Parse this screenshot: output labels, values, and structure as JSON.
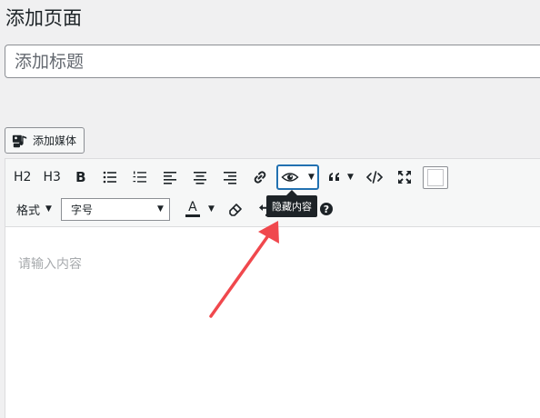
{
  "page": {
    "title": "添加页面"
  },
  "title_input": {
    "placeholder": "添加标题"
  },
  "media": {
    "label": "添加媒体",
    "icon": "media-icon"
  },
  "toolbar": {
    "h2": "H2",
    "h3": "H3",
    "bold": "B",
    "format_label": "格式",
    "font_size_label": "字号"
  },
  "tooltip": {
    "text": "隐藏内容"
  },
  "editor": {
    "placeholder": "请输入内容"
  },
  "colors": {
    "accent": "#2271b1",
    "arrow": "#f0484d",
    "tooltip_bg": "#1d2327"
  }
}
